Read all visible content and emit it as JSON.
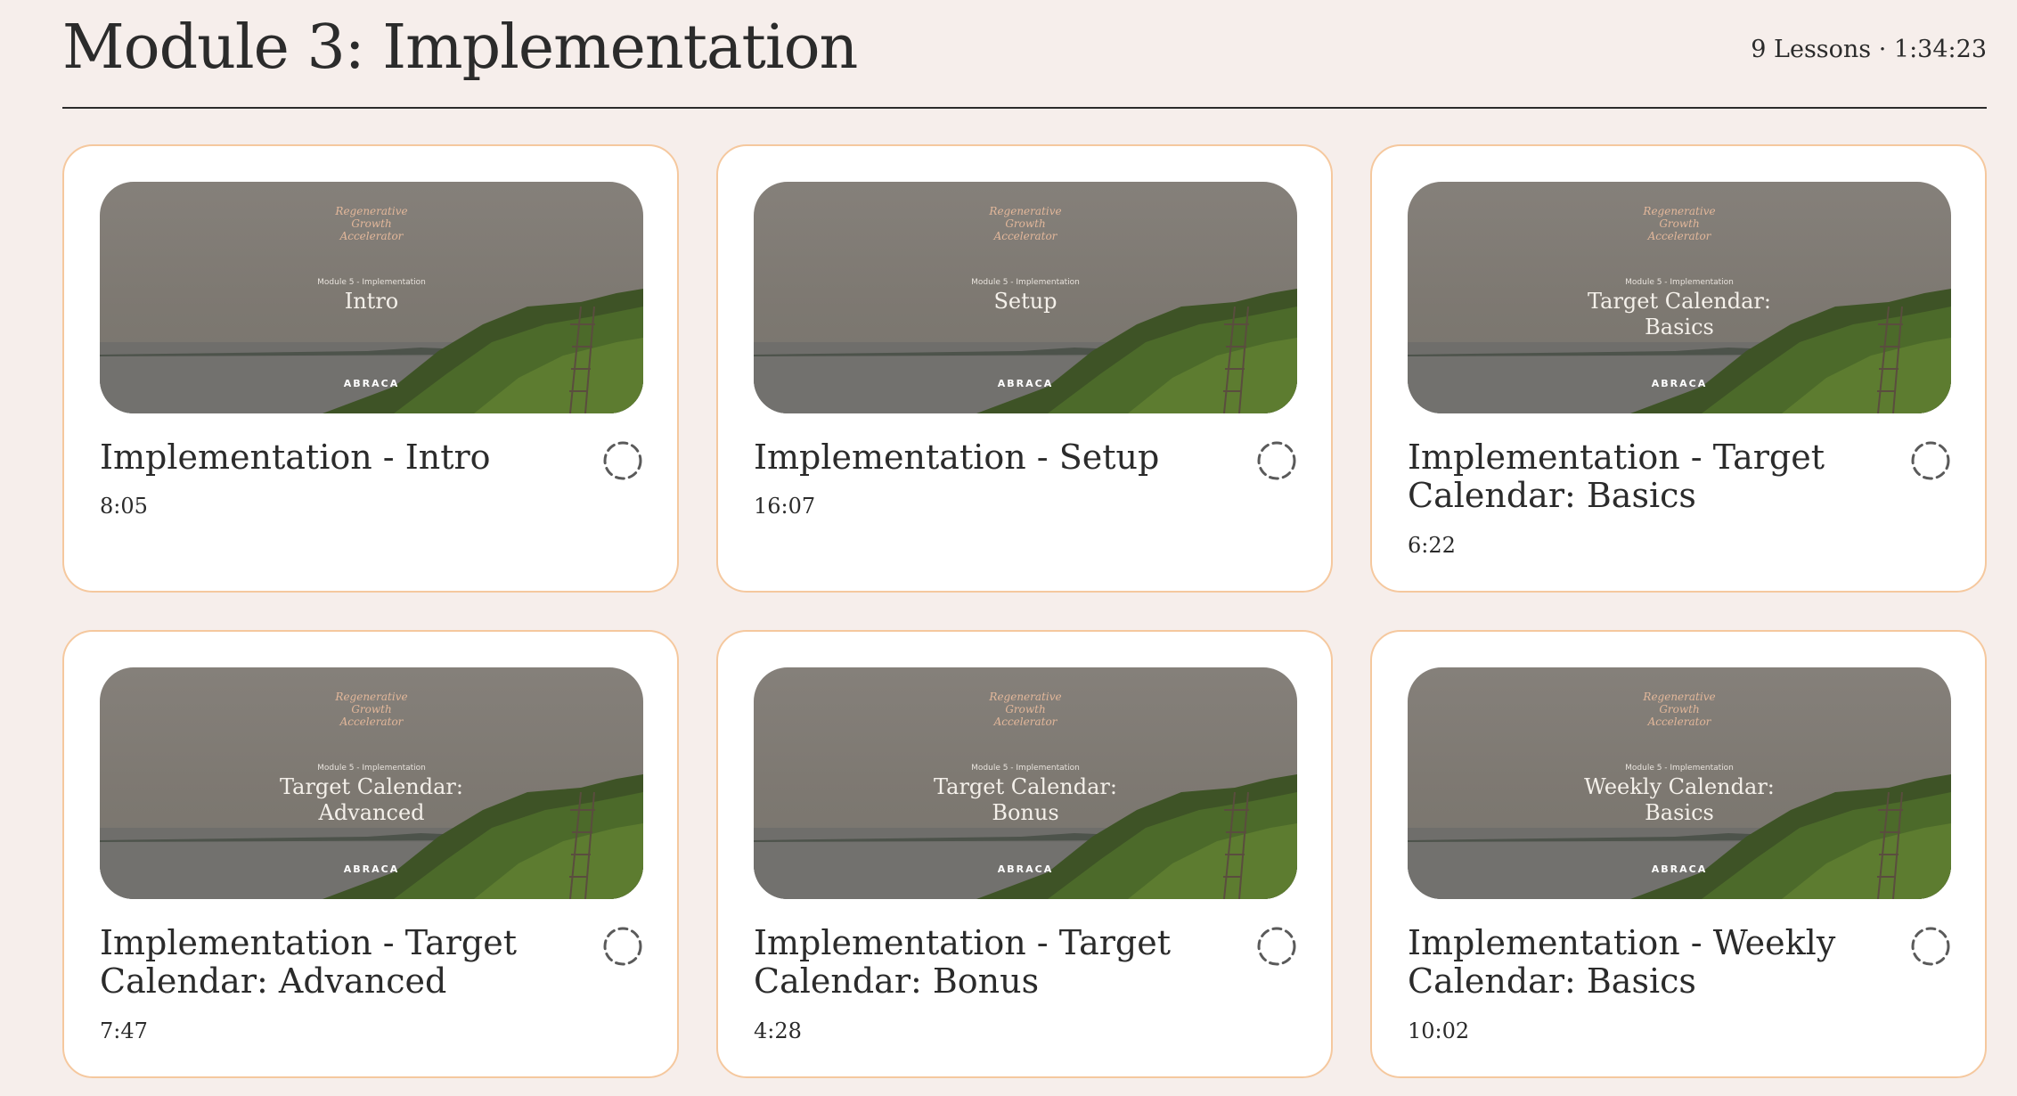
{
  "module": {
    "title": "Module 3: Implementation",
    "meta": "9 Lessons · 1:34:23"
  },
  "thumbnail": {
    "brand_lines": [
      "Regenerative",
      "Growth",
      "Accelerator"
    ],
    "module_label": "Module 5 - Implementation",
    "logo": "ABRACA"
  },
  "lessons": [
    {
      "title_lines": [
        "Implementation - Intro"
      ],
      "duration": "8:05",
      "thumb_lines": [
        "Intro"
      ],
      "status_icon": "progress-circle-icon"
    },
    {
      "title_lines": [
        "Implementation - Setup"
      ],
      "duration": "16:07",
      "thumb_lines": [
        "Setup"
      ],
      "status_icon": "progress-circle-icon"
    },
    {
      "title_lines": [
        "Implementation - Target",
        "Calendar: Basics"
      ],
      "duration": "6:22",
      "thumb_lines": [
        "Target Calendar:",
        "Basics"
      ],
      "status_icon": "progress-circle-icon"
    },
    {
      "title_lines": [
        "Implementation - Target",
        "Calendar: Advanced"
      ],
      "duration": "7:47",
      "thumb_lines": [
        "Target Calendar:",
        "Advanced"
      ],
      "status_icon": "progress-circle-icon"
    },
    {
      "title_lines": [
        "Implementation - Target",
        "Calendar: Bonus"
      ],
      "duration": "4:28",
      "thumb_lines": [
        "Target Calendar:",
        "Bonus"
      ],
      "status_icon": "progress-circle-icon"
    },
    {
      "title_lines": [
        "Implementation - Weekly",
        "Calendar: Basics"
      ],
      "duration": "10:02",
      "thumb_lines": [
        "Weekly Calendar:",
        "Basics"
      ],
      "status_icon": "progress-circle-icon"
    }
  ],
  "colors": {
    "background": "#f6eeeb",
    "card_border": "#f5c89e",
    "text": "#2b2b2b",
    "brand_text": "#e2b79a"
  }
}
